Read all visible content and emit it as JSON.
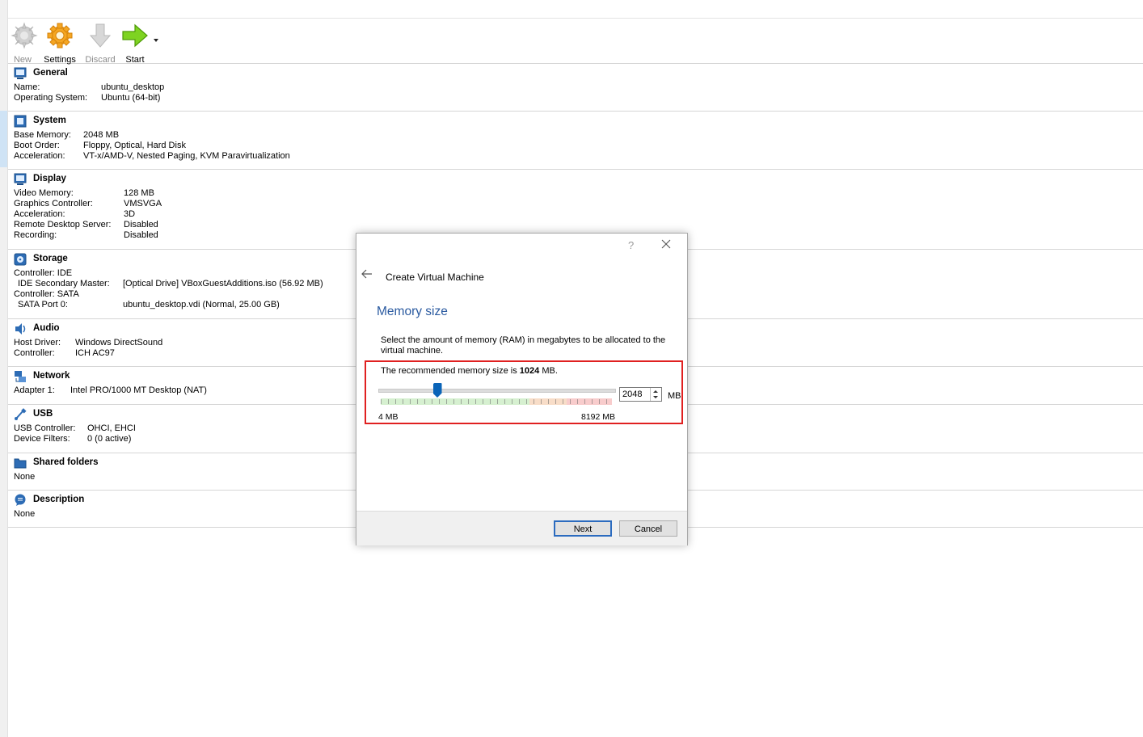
{
  "toolbar": {
    "new_label": "New",
    "settings_label": "Settings",
    "discard_label": "Discard",
    "start_label": "Start"
  },
  "details": {
    "general": {
      "title": "General",
      "rows": [
        {
          "k": "Name:",
          "v": "ubuntu_desktop"
        },
        {
          "k": "Operating System:",
          "v": "Ubuntu (64-bit)"
        }
      ]
    },
    "system": {
      "title": "System",
      "rows": [
        {
          "k": "Base Memory:",
          "v": "2048 MB"
        },
        {
          "k": "Boot Order:",
          "v": "Floppy, Optical, Hard Disk"
        },
        {
          "k": "Acceleration:",
          "v": "VT-x/AMD-V, Nested Paging, KVM Paravirtualization"
        }
      ]
    },
    "display": {
      "title": "Display",
      "rows": [
        {
          "k": "Video Memory:",
          "v": "128 MB"
        },
        {
          "k": "Graphics Controller:",
          "v": "VMSVGA"
        },
        {
          "k": "Acceleration:",
          "v": "3D"
        },
        {
          "k": "Remote Desktop Server:",
          "v": "Disabled"
        },
        {
          "k": "Recording:",
          "v": "Disabled"
        }
      ]
    },
    "storage": {
      "title": "Storage",
      "rows": [
        {
          "k": "Controller: IDE",
          "v": ""
        },
        {
          "k": " IDE Secondary Master:",
          "v": "[Optical Drive] VBoxGuestAdditions.iso (56.92 MB)"
        },
        {
          "k": "Controller: SATA",
          "v": ""
        },
        {
          "k": " SATA Port 0:",
          "v": "ubuntu_desktop.vdi (Normal, 25.00 GB)"
        }
      ]
    },
    "audio": {
      "title": "Audio",
      "rows": [
        {
          "k": "Host Driver:",
          "v": "Windows DirectSound"
        },
        {
          "k": "Controller:",
          "v": "ICH AC97"
        }
      ]
    },
    "network": {
      "title": "Network",
      "rows": [
        {
          "k": "Adapter 1:",
          "v": "Intel PRO/1000 MT Desktop (NAT)"
        }
      ]
    },
    "usb": {
      "title": "USB",
      "rows": [
        {
          "k": "USB Controller:",
          "v": "OHCI, EHCI"
        },
        {
          "k": "Device Filters:",
          "v": "0 (0 active)"
        }
      ]
    },
    "shared_folders": {
      "title": "Shared folders",
      "rows": [
        {
          "k": "None",
          "v": ""
        }
      ]
    },
    "description": {
      "title": "Description",
      "rows": [
        {
          "k": "None",
          "v": ""
        }
      ]
    }
  },
  "dialog": {
    "help": "?",
    "title": "Create Virtual Machine",
    "heading": "Memory size",
    "description": "Select the amount of memory (RAM) in megabytes to be allocated to the virtual machine.",
    "recommended_prefix": "The recommended memory size is ",
    "recommended_value": "1024",
    "recommended_suffix": " MB.",
    "slider_min_label": "4 MB",
    "slider_max_label": "8192 MB",
    "memory_value": "2048",
    "memory_fraction": 0.25,
    "unit": "MB",
    "next_label": "Next",
    "cancel_label": "Cancel"
  },
  "colors": {
    "heading_blue": "#2a5aa0",
    "highlight_red": "#e02020",
    "slider_thumb": "#0a64b8"
  }
}
